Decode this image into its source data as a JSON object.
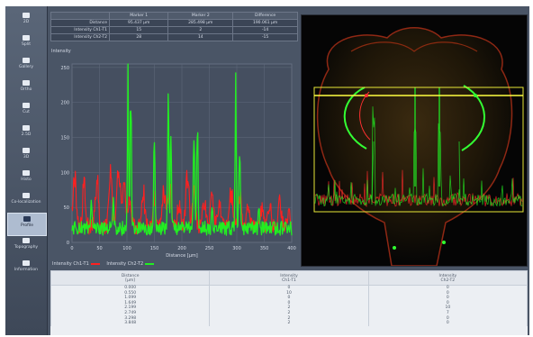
{
  "sidebar": {
    "items": [
      {
        "label": "2D",
        "icon": "grid-icon"
      },
      {
        "label": "Split",
        "icon": "split-icon"
      },
      {
        "label": "Gallery",
        "icon": "gallery-icon"
      },
      {
        "label": "Ortho",
        "icon": "ortho-icon"
      },
      {
        "label": "Cut",
        "icon": "cut-icon"
      },
      {
        "label": "2.5D",
        "icon": "surface-icon"
      },
      {
        "label": "3D",
        "icon": "cube-icon"
      },
      {
        "label": "Histo",
        "icon": "histogram-icon"
      },
      {
        "label": "Co-localization",
        "icon": "colocalization-icon"
      },
      {
        "label": "Profile",
        "icon": "profile-icon"
      },
      {
        "label": "Topography",
        "icon": "topography-icon"
      },
      {
        "label": "Information",
        "icon": "info-icon"
      }
    ],
    "active_index": 9
  },
  "marker_table": {
    "headers": [
      "",
      "Marker 1",
      "Marker 2",
      "Difference"
    ],
    "rows": [
      [
        "Distance",
        "95.437 µm",
        "285.498 µm",
        "190.061 µm"
      ],
      [
        "Intensity Ch1-T1",
        "15",
        "2",
        "-14"
      ],
      [
        "Intensity Ch2-T2",
        "28",
        "14",
        "-15"
      ]
    ]
  },
  "chart_title": "Intensity",
  "legend": {
    "ch1": "Intensity Ch1-T1",
    "ch2": "Intensity Ch2-T2"
  },
  "chart_data": {
    "type": "line",
    "xlabel": "Distance [µm]",
    "ylabel": "Intensity",
    "xlim": [
      0,
      400
    ],
    "ylim": [
      0,
      255
    ],
    "xticks": [
      0,
      50,
      100,
      150,
      200,
      250,
      300,
      350,
      400
    ],
    "yticks": [
      0,
      50,
      100,
      150,
      200,
      250
    ],
    "grid": true,
    "series": [
      {
        "name": "Intensity Ch1-T1",
        "color": "#ff2020",
        "peaks": [
          [
            5,
            100
          ],
          [
            22,
            75
          ],
          [
            45,
            88
          ],
          [
            70,
            95
          ],
          [
            85,
            115
          ],
          [
            95,
            70
          ],
          [
            105,
            50
          ],
          [
            130,
            60
          ],
          [
            150,
            55
          ],
          [
            168,
            70
          ],
          [
            178,
            85
          ],
          [
            195,
            40
          ],
          [
            210,
            95
          ],
          [
            222,
            65
          ],
          [
            240,
            55
          ],
          [
            255,
            60
          ],
          [
            268,
            40
          ],
          [
            290,
            60
          ],
          [
            305,
            55
          ],
          [
            320,
            30
          ],
          [
            345,
            35
          ],
          [
            360,
            40
          ],
          [
            378,
            45
          ],
          [
            395,
            30
          ]
        ],
        "base": 22
      },
      {
        "name": "Intensity Ch2-T2",
        "color": "#22ee22",
        "peaks": [
          [
            102,
            255
          ],
          [
            107,
            250
          ],
          [
            150,
            165
          ],
          [
            175,
            215
          ],
          [
            180,
            150
          ],
          [
            222,
            200
          ],
          [
            228,
            215
          ],
          [
            298,
            235
          ],
          [
            305,
            175
          ],
          [
            35,
            45
          ],
          [
            75,
            50
          ],
          [
            255,
            40
          ],
          [
            340,
            35
          ]
        ],
        "base": 20
      }
    ]
  },
  "data_table": {
    "headers": [
      "Distance\n[µm]",
      "Intensity\nCh1-T1",
      "Intensity\nCh2-T2"
    ],
    "rows": [
      [
        "0.000",
        "0",
        "0"
      ],
      [
        "0.550",
        "10",
        "0"
      ],
      [
        "1.099",
        "0",
        "0"
      ],
      [
        "1.649",
        "0",
        "0"
      ],
      [
        "2.199",
        "2",
        "10"
      ],
      [
        "2.749",
        "2",
        "7"
      ],
      [
        "3.298",
        "2",
        "0"
      ],
      [
        "3.848",
        "2",
        "0"
      ]
    ]
  }
}
